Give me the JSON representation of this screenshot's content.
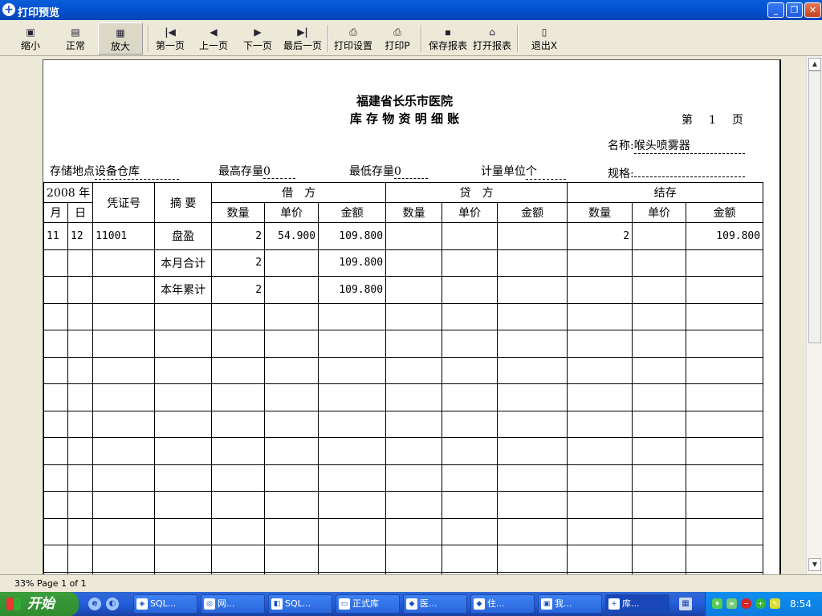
{
  "window": {
    "title": "打印预览",
    "controls": {
      "minimize": "_",
      "restore": "❐",
      "close": "✕"
    }
  },
  "toolbar": {
    "shrink": "缩小",
    "normal": "正常",
    "zoom_in": "放大",
    "first_page": "第一页",
    "prev_page": "上一页",
    "next_page": "下一页",
    "last_page": "最后一页",
    "print_setup": "打印设置",
    "print": "打印P",
    "save_report": "保存报表",
    "open_report": "打开报表",
    "exit": "退出X"
  },
  "report": {
    "hospital": "福建省长乐市医院",
    "title": "库 存 物 资 明 细 账",
    "page_prefix": "第",
    "page_number": "1",
    "page_suffix": "页",
    "name_label": "名称:",
    "name_value": "喉头喷雾器",
    "spec_label": "规格:",
    "spec_value": "",
    "storage_label": "存储地点",
    "storage_value": "设备仓库",
    "max_stock_label": "最高存量",
    "max_stock_value": "0",
    "min_stock_label": "最低存量",
    "min_stock_value": "0",
    "unit_label": "计量单位",
    "unit_value": "个"
  },
  "table": {
    "year_header": "2008 年",
    "month": "月",
    "day": "日",
    "voucher": "凭证号",
    "summary": "摘 要",
    "debit": "借　方",
    "credit": "贷　方",
    "balance": "结存",
    "qty": "数量",
    "price": "单价",
    "amount": "金额",
    "rows": [
      {
        "month": "11",
        "day": "12",
        "voucher": "11001",
        "summary": "盘盈",
        "d_qty": "2",
        "d_price": "54.900",
        "d_amount": "109.800",
        "c_qty": "",
        "c_price": "",
        "c_amount": "",
        "b_qty": "2",
        "b_price": "",
        "b_amount": "109.800"
      },
      {
        "month": "",
        "day": "",
        "voucher": "",
        "summary": "本月合计",
        "d_qty": "2",
        "d_price": "",
        "d_amount": "109.800",
        "c_qty": "",
        "c_price": "",
        "c_amount": "",
        "b_qty": "",
        "b_price": "",
        "b_amount": ""
      },
      {
        "month": "",
        "day": "",
        "voucher": "",
        "summary": "本年累计",
        "d_qty": "2",
        "d_price": "",
        "d_amount": "109.800",
        "c_qty": "",
        "c_price": "",
        "c_amount": "",
        "b_qty": "",
        "b_price": "",
        "b_amount": ""
      }
    ]
  },
  "status": {
    "text": "33% Page 1 of 1"
  },
  "taskbar": {
    "start": "开始",
    "tasks": [
      "SQL...",
      "网...",
      "SQL...",
      "正式库",
      "医...",
      "住...",
      "我...",
      "库..."
    ],
    "clock": "8:54"
  }
}
